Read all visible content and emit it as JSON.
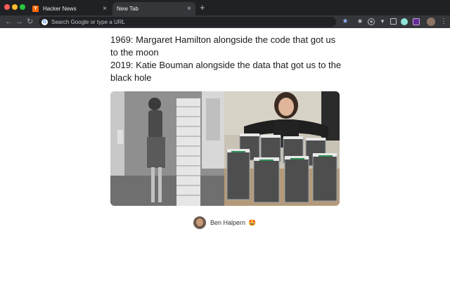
{
  "browser": {
    "tabs": [
      {
        "favicon": "Y",
        "label": "Hacker News",
        "active": false
      },
      {
        "label": "New Tab",
        "active": true
      }
    ],
    "new_tab_symbol": "+",
    "omnibox_placeholder": "Search Google or type a URL",
    "omnibox_icon": "G"
  },
  "post": {
    "caption_lines": [
      "1969: Margaret Hamilton alongside the code that got us to the moon",
      "2019: Katie Bouman alongside the data that got us to the black hole"
    ],
    "author": "Ben Halpern",
    "author_emoji": "🤩"
  }
}
